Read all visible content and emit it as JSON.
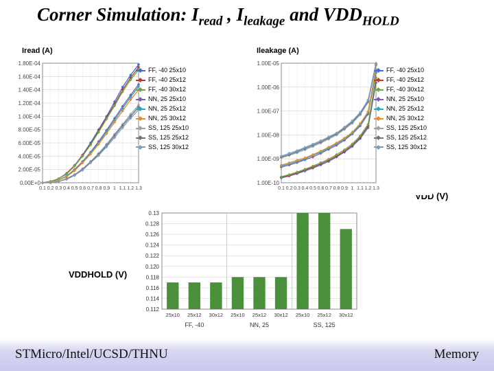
{
  "title_parts": {
    "a": "Corner Simulation: I",
    "b": "read",
    "c": " , I",
    "d": "leakage",
    "e": " and VDD",
    "f": "HOLD"
  },
  "labels": {
    "iread": "Iread (A)",
    "ileak": "Ileakage (A)",
    "vdd": "VDD (V)",
    "vddhold": "VDDHOLD (V)"
  },
  "footer": {
    "left": "STMicro/Intel/UCSD/THNU",
    "right": "Memory"
  },
  "series": [
    {
      "name": "FF, -40 25x10",
      "color": "#3a6fd8"
    },
    {
      "name": "FF, -40 25x12",
      "color": "#c0392b"
    },
    {
      "name": "FF, -40 30x12",
      "color": "#6aa845"
    },
    {
      "name": "NN, 25 25x10",
      "color": "#7e5bb5"
    },
    {
      "name": "NN, 25 25x12",
      "color": "#2aa6b5"
    },
    {
      "name": "NN, 25 30x12",
      "color": "#e38d2b"
    },
    {
      "name": "SS, 125 25x10",
      "color": "#9aa3ab"
    },
    {
      "name": "SS, 125 25x12",
      "color": "#6d7680"
    },
    {
      "name": "SS, 125 30x12",
      "color": "#7a9fbf"
    }
  ],
  "chart_data": [
    {
      "type": "line",
      "id": "iread",
      "xlabel": "",
      "ylabel": "Iread (A)",
      "x": [
        0.1,
        0.2,
        0.3,
        0.4,
        0.5,
        0.6,
        0.7,
        0.8,
        0.9,
        1.0,
        1.1,
        1.2,
        1.3
      ],
      "ylim": [
        0,
        0.00018
      ],
      "yticks": [
        "0.00E+0",
        "2.00E-05",
        "4.00E-05",
        "6.00E-05",
        "8.00E-05",
        "1.00E-04",
        "1.20E-04",
        "1.40E-04",
        "1.60E-04",
        "1.80E-04"
      ],
      "series": [
        {
          "name": "FF, -40 25x10",
          "values": [
            0,
            2e-06,
            6e-06,
            1.4e-05,
            2.6e-05,
            4.2e-05,
            6e-05,
            8e-05,
            0.0001,
            0.000122,
            0.000144,
            0.000162,
            0.000178
          ]
        },
        {
          "name": "FF, -40 25x12",
          "values": [
            0,
            2e-06,
            6e-06,
            1.4e-05,
            2.6e-05,
            4.1e-05,
            5.8e-05,
            7.8e-05,
            9.8e-05,
            0.000118,
            0.00014,
            0.000158,
            0.000174
          ]
        },
        {
          "name": "FF, -40 30x12",
          "values": [
            0,
            2e-06,
            6e-06,
            1.3e-05,
            2.5e-05,
            4e-05,
            5.7e-05,
            7.6e-05,
            9.6e-05,
            0.000116,
            0.000137,
            0.000155,
            0.00017
          ]
        },
        {
          "name": "NN, 25 25x10",
          "values": [
            0,
            1e-06,
            4e-06,
            1e-05,
            2e-05,
            3.2e-05,
            4.6e-05,
            6.2e-05,
            7.9e-05,
            9.7e-05,
            0.000115,
            0.000132,
            0.000148
          ]
        },
        {
          "name": "NN, 25 25x12",
          "values": [
            0,
            1e-06,
            4e-06,
            1e-05,
            1.9e-05,
            3.1e-05,
            4.5e-05,
            6e-05,
            7.7e-05,
            9.4e-05,
            0.000112,
            0.000129,
            0.000145
          ]
        },
        {
          "name": "NN, 25 30x12",
          "values": [
            0,
            1e-06,
            4e-06,
            9e-06,
            1.8e-05,
            3e-05,
            4.3e-05,
            5.8e-05,
            7.4e-05,
            9.1e-05,
            0.000108,
            0.000125,
            0.00014
          ]
        },
        {
          "name": "SS, 125 25x10",
          "values": [
            0,
            0,
            2e-06,
            6e-06,
            1.2e-05,
            2.1e-05,
            3.2e-05,
            4.4e-05,
            5.8e-05,
            7.3e-05,
            8.8e-05,
            0.000103,
            0.000117
          ]
        },
        {
          "name": "SS, 125 25x12",
          "values": [
            0,
            0,
            2e-06,
            6e-06,
            1.2e-05,
            2e-05,
            3.1e-05,
            4.3e-05,
            5.6e-05,
            7.1e-05,
            8.6e-05,
            0.0001,
            0.000114
          ]
        },
        {
          "name": "SS, 125 30x12",
          "values": [
            0,
            0,
            2e-06,
            5e-06,
            1.1e-05,
            1.9e-05,
            3e-05,
            4.1e-05,
            5.4e-05,
            6.8e-05,
            8.3e-05,
            9.7e-05,
            0.00011
          ]
        }
      ]
    },
    {
      "type": "line",
      "id": "ileakage",
      "xlabel": "",
      "ylabel": "Ileakage (A)",
      "x": [
        0.1,
        0.2,
        0.3,
        0.4,
        0.5,
        0.6,
        0.7,
        0.8,
        0.9,
        1.0,
        1.1,
        1.2,
        1.3
      ],
      "ylim_log": [
        1e-10,
        1e-05
      ],
      "yticks": [
        "1.00E-10",
        "1.00E-09",
        "1.00E-08",
        "1.00E-07",
        "1.00E-06",
        "1.00E-05"
      ],
      "series": [
        {
          "name": "FF, -40 25x10",
          "values": [
            1.6e-10,
            1.9e-10,
            2.4e-10,
            3.1e-10,
            4.1e-10,
            5.6e-10,
            7.8e-10,
            1.2e-09,
            1.9e-09,
            3.3e-09,
            7e-09,
            2e-08,
            1.5e-06
          ]
        },
        {
          "name": "FF, -40 25x12",
          "values": [
            1.7e-10,
            2e-10,
            2.6e-10,
            3.4e-10,
            4.5e-10,
            6.2e-10,
            8.7e-10,
            1.3e-09,
            2.1e-09,
            3.7e-09,
            8e-09,
            2.4e-08,
            2e-06
          ]
        },
        {
          "name": "FF, -40 30x12",
          "values": [
            1.8e-10,
            2.2e-10,
            2.8e-10,
            3.7e-10,
            5e-10,
            6.9e-10,
            9.7e-10,
            1.5e-09,
            2.4e-09,
            4.2e-09,
            9.2e-09,
            2.8e-08,
            2.5e-06
          ]
        },
        {
          "name": "NN, 25 25x10",
          "values": [
            4.5e-10,
            5.5e-10,
            7e-10,
            9.1e-10,
            1.2e-09,
            1.7e-09,
            2.5e-09,
            3.7e-09,
            6e-09,
            1.1e-08,
            2.4e-08,
            7.5e-08,
            4e-06
          ]
        },
        {
          "name": "NN, 25 25x12",
          "values": [
            5e-10,
            6.1e-10,
            7.8e-10,
            1e-09,
            1.4e-09,
            1.9e-09,
            2.8e-09,
            4.2e-09,
            6.7e-09,
            1.2e-08,
            2.7e-08,
            8.5e-08,
            4.7e-06
          ]
        },
        {
          "name": "NN, 25 30x12",
          "values": [
            5.5e-10,
            6.8e-10,
            8.7e-10,
            1.1e-09,
            1.5e-09,
            2.1e-09,
            3.1e-09,
            4.6e-09,
            7.4e-09,
            1.3e-08,
            3e-08,
            9.5e-08,
            5.5e-06
          ]
        },
        {
          "name": "SS, 125 25x10",
          "values": [
            1.1e-09,
            1.4e-09,
            1.8e-09,
            2.4e-09,
            3.3e-09,
            4.6e-09,
            6.7e-09,
            1e-08,
            1.7e-08,
            3.1e-08,
            7e-08,
            2.3e-07,
            8e-06
          ]
        },
        {
          "name": "SS, 125 25x12",
          "values": [
            1.2e-09,
            1.5e-09,
            2e-09,
            2.7e-09,
            3.7e-09,
            5.1e-09,
            7.5e-09,
            1.1e-08,
            1.9e-08,
            3.5e-08,
            7.8e-08,
            2.6e-07,
            9e-06
          ]
        },
        {
          "name": "SS, 125 30x12",
          "values": [
            1.3e-09,
            1.7e-09,
            2.2e-09,
            3e-09,
            4.1e-09,
            5.7e-09,
            8.3e-09,
            1.2e-08,
            2.1e-08,
            3.9e-08,
            8.7e-08,
            2.9e-07,
            1e-05
          ]
        }
      ]
    },
    {
      "type": "bar",
      "id": "vddhold",
      "ylabel": "VDDHOLD (V)",
      "ylim": [
        0.112,
        0.13
      ],
      "yticks": [
        "0.112",
        "0.114",
        "0.116",
        "0.118",
        "0.120",
        "0.122",
        "0.124",
        "0.126",
        "0.128",
        "0.13"
      ],
      "groups": [
        "FF, -40",
        "NN, 25",
        "SS, 125"
      ],
      "categories": [
        "25x10",
        "25x12",
        "30x12",
        "25x10",
        "25x12",
        "30x12",
        "25x10",
        "25x12",
        "30x12"
      ],
      "values": [
        0.117,
        0.117,
        0.117,
        0.118,
        0.118,
        0.118,
        0.13,
        0.13,
        0.127
      ],
      "color": "#4a8f3a"
    }
  ]
}
